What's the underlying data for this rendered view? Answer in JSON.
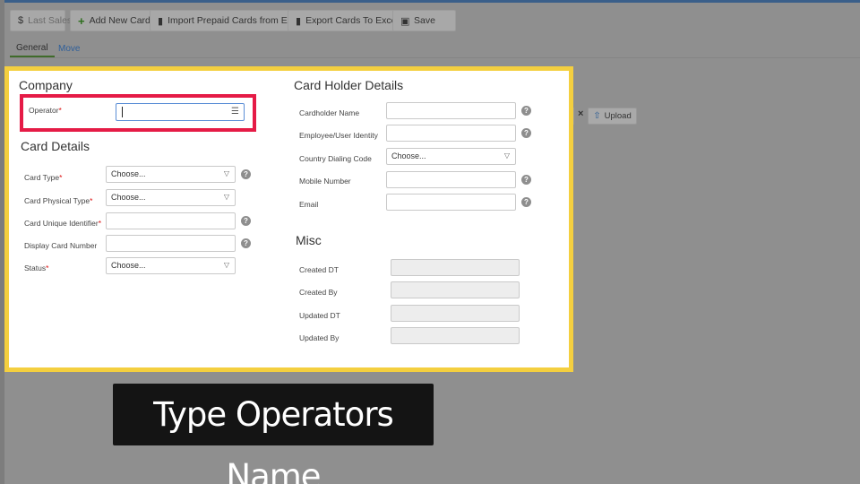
{
  "toolbar": {
    "last_sales": "Last Sales",
    "add_new_card": "Add New Card",
    "import_prepaid": "Import Prepaid Cards from Excel",
    "export_cards": "Export Cards To Excel",
    "save": "Save"
  },
  "tabs": {
    "general": "General",
    "move": "Move"
  },
  "company": {
    "title": "Company",
    "operator_label": "Operator",
    "required_mark": "*",
    "operator_value": ""
  },
  "card_details": {
    "title": "Card Details",
    "card_type_label": "Card Type",
    "card_type_value": "Choose...",
    "card_physical_type_label": "Card Physical Type",
    "card_physical_type_value": "Choose...",
    "card_unique_identifier_label": "Card Unique Identifier",
    "display_card_number_label": "Display Card Number",
    "status_label": "Status",
    "status_value": "Choose..."
  },
  "card_holder": {
    "title": "Card Holder Details",
    "cardholder_name_label": "Cardholder Name",
    "employee_identity_label": "Employee/User Identity",
    "country_dialing_code_label": "Country Dialing Code",
    "country_dialing_code_value": "Choose...",
    "mobile_number_label": "Mobile Number",
    "email_label": "Email"
  },
  "misc": {
    "title": "Misc",
    "created_dt_label": "Created DT",
    "created_by_label": "Created By",
    "updated_dt_label": "Updated DT",
    "updated_by_label": "Updated By"
  },
  "upload": {
    "clear": "×",
    "label": "Upload"
  },
  "icons": {
    "help": "?",
    "caret": "▽",
    "dollar": "$",
    "plus": "+",
    "file": "▮",
    "save": "▣",
    "list": "☰",
    "upload": "⇧"
  },
  "caption": "Type Operators Name",
  "colors": {
    "highlight_frame": "#f4cf3f",
    "operator_highlight": "#e51b46",
    "active_input_border": "#5b8ed6",
    "tab_link": "#2f5f9a"
  }
}
